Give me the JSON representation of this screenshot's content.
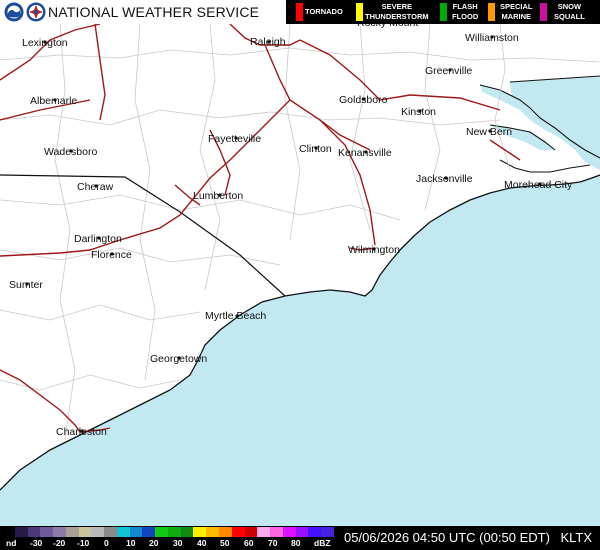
{
  "header": {
    "title": "NATIONAL WEATHER SERVICE"
  },
  "legend": [
    {
      "label": "TORNADO",
      "color": "#ff0000"
    },
    {
      "label": "SEVERE\nTHUNDERSTORM",
      "color": "#ffff00"
    },
    {
      "label": "FLASH\nFLOOD",
      "color": "#00aa00"
    },
    {
      "label": "SPECIAL\nMARINE",
      "color": "#ff9900"
    },
    {
      "label": "SNOW\nSQUALL",
      "color": "#cc1199"
    }
  ],
  "cities": [
    "Lexington",
    "Raleigh",
    "Rocky Mount",
    "Williamston",
    "Greenville",
    "Albemarle",
    "Goldsboro",
    "Kinston",
    "Fayetteville",
    "New Bern",
    "Wadesboro",
    "Clinton",
    "Kenansville",
    "Jacksonville",
    "Cheraw",
    "Morehead City",
    "Lumberton",
    "Darlington",
    "Florence",
    "Wilmington",
    "Sumter",
    "Myrtle Beach",
    "Georgetown",
    "Charleston"
  ],
  "scale": {
    "labels": [
      "nd",
      "-30",
      "-20",
      "-10",
      "0",
      "10",
      "20",
      "30",
      "40",
      "50",
      "60",
      "70",
      "80",
      "dBZ"
    ],
    "colors": [
      "#000000",
      "#2a1a4a",
      "#4b3a7a",
      "#6d5a9a",
      "#8d7aa8",
      "#a8a090",
      "#c8c4a0",
      "#b8b8b8",
      "#8a8a8a",
      "#11c4d4",
      "#1188cc",
      "#1144bb",
      "#11cc11",
      "#11aa11",
      "#118811",
      "#ffee00",
      "#ffbb00",
      "#ff8800",
      "#ff0000",
      "#cc0000",
      "#ffaaee",
      "#ff66dd",
      "#dd11ff",
      "#9911ff",
      "#4411ff",
      "#4422dd"
    ]
  },
  "footer": {
    "timestamp": "05/06/2026 04:50 UTC (00:50 EDT)",
    "station": "KLTX"
  }
}
